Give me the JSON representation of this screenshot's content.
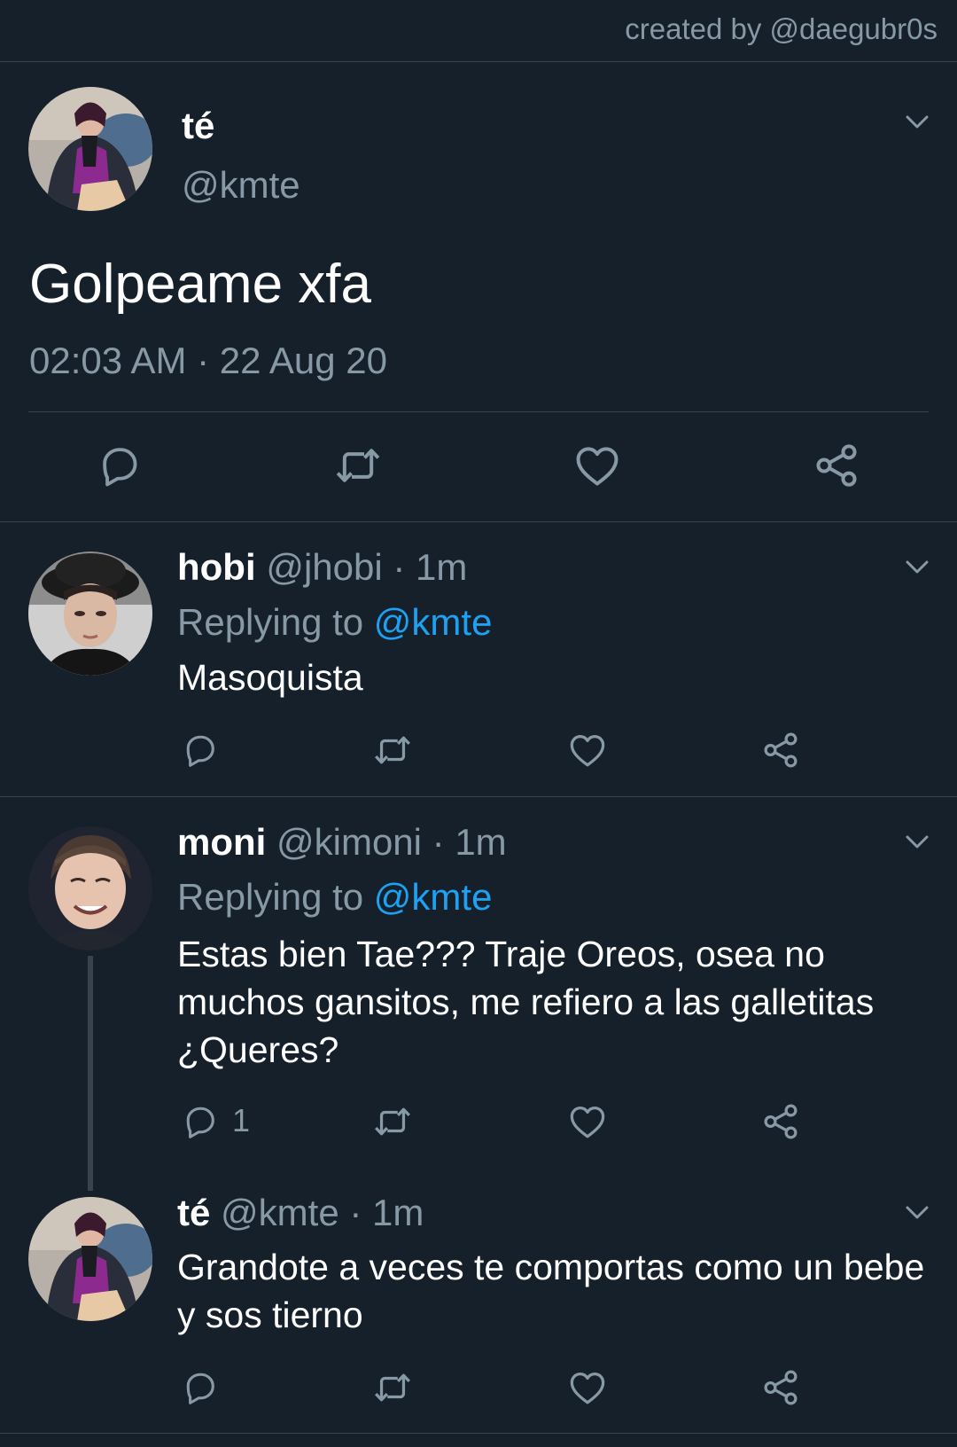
{
  "credit": "created by @daegubr0s",
  "main_tweet": {
    "name": "té",
    "handle": "@kmte",
    "text": "Golpeame xfa",
    "timestamp": "02:03 AM · 22 Aug 20",
    "actions": [
      "reply-icon",
      "retweet-icon",
      "like-icon",
      "share-icon"
    ]
  },
  "replies": [
    {
      "name": "hobi",
      "handle_time": "@jhobi · 1m",
      "replying_label": "Replying to",
      "replying_to": "@kmte",
      "text": "Masoquista",
      "reply_count": ""
    },
    {
      "name": "moni",
      "handle_time": "@kimoni · 1m",
      "replying_label": "Replying to",
      "replying_to": "@kmte",
      "text": "Estas bien Tae??? Traje Oreos, osea no muchos gansitos, me refiero a las galletitas ¿Queres?",
      "reply_count": "1"
    },
    {
      "name": "té",
      "handle_time": "@kmte · 1m",
      "text": "Grandote a veces te comportas como un bebe y sos tierno",
      "reply_count": ""
    }
  ],
  "colors": {
    "background": "#15202b",
    "secondary_text": "#8899a6",
    "link": "#1da1f2",
    "divider": "#38444d"
  }
}
